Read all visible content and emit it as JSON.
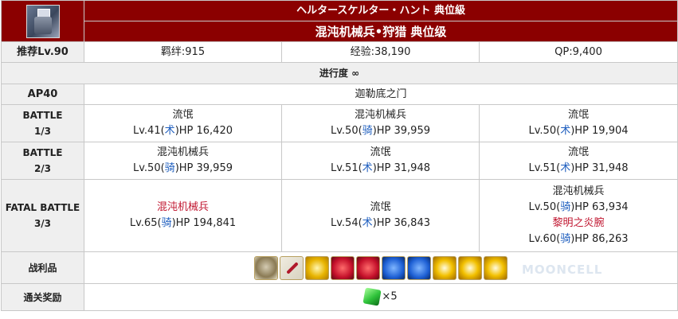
{
  "header": {
    "title_jp": "ヘルタースケルター・ハント 典位級",
    "title_cn": "混沌机械兵•狩猎 典位级",
    "thumbnail_icon": "quest-thumbnail-icon"
  },
  "info": {
    "recommended_level": "推荐Lv.90",
    "bond": "羁绊:915",
    "exp": "经验:38,190",
    "qp": "QP:9,400"
  },
  "progress": {
    "label": "进行度 ∞"
  },
  "ap": {
    "label": "AP40",
    "location": "迦勒底之门"
  },
  "battles": [
    {
      "label_line1": "BATTLE",
      "label_line2": "1/3",
      "enemies": [
        {
          "name": "流氓",
          "level": "Lv.41(",
          "class": "术",
          "hp": ")HP 16,420"
        },
        {
          "name": "混沌机械兵",
          "level": "Lv.50(",
          "class": "骑",
          "hp": ")HP 39,959"
        },
        {
          "name": "流氓",
          "level": "Lv.50(",
          "class": "术",
          "hp": ")HP 19,904"
        }
      ]
    },
    {
      "label_line1": "BATTLE",
      "label_line2": "2/3",
      "enemies": [
        {
          "name": "混沌机械兵",
          "level": "Lv.50(",
          "class": "骑",
          "hp": ")HP 39,959"
        },
        {
          "name": "流氓",
          "level": "Lv.51(",
          "class": "术",
          "hp": ")HP 31,948"
        },
        {
          "name": "流氓",
          "level": "Lv.51(",
          "class": "术",
          "hp": ")HP 31,948"
        }
      ]
    },
    {
      "label_line1": "FATAL BATTLE",
      "label_line2": "3/3",
      "enemies": [
        {
          "name": "混沌机械兵",
          "level": "Lv.65(",
          "class": "骑",
          "hp": ")HP 194,841"
        },
        {
          "name": "流氓",
          "level": "Lv.54(",
          "class": "术",
          "hp": ")HP 36,843"
        }
      ],
      "last_cell": [
        {
          "name": "混沌机械兵",
          "level": "Lv.50(",
          "class": "骑",
          "hp": ")HP 63,934"
        },
        {
          "name": "黎明之炎腕",
          "level": "Lv.60(",
          "class": "骑",
          "hp": ")HP 86,263"
        }
      ]
    }
  ],
  "drops": {
    "label": "战利品",
    "items": [
      "shell-item-icon",
      "feather-item-icon",
      "gold-gem-item-icon",
      "red-gem-item-icon",
      "red-magic-gem-item-icon",
      "blue-gem-item-icon",
      "blue-magic-gem-item-icon",
      "gold-piece-item-icon",
      "gold-monument-item-icon",
      "gold-piece2-item-icon"
    ]
  },
  "reward": {
    "label": "通关奖励",
    "icon": "green-gem-icon",
    "count": "×5"
  },
  "watermark": "MOONCELL",
  "colors": {
    "header_bg": "#8b0000",
    "label_bg": "#efefef",
    "class_blue": "#1f5fbf",
    "highlight_red": "#c0152f"
  }
}
